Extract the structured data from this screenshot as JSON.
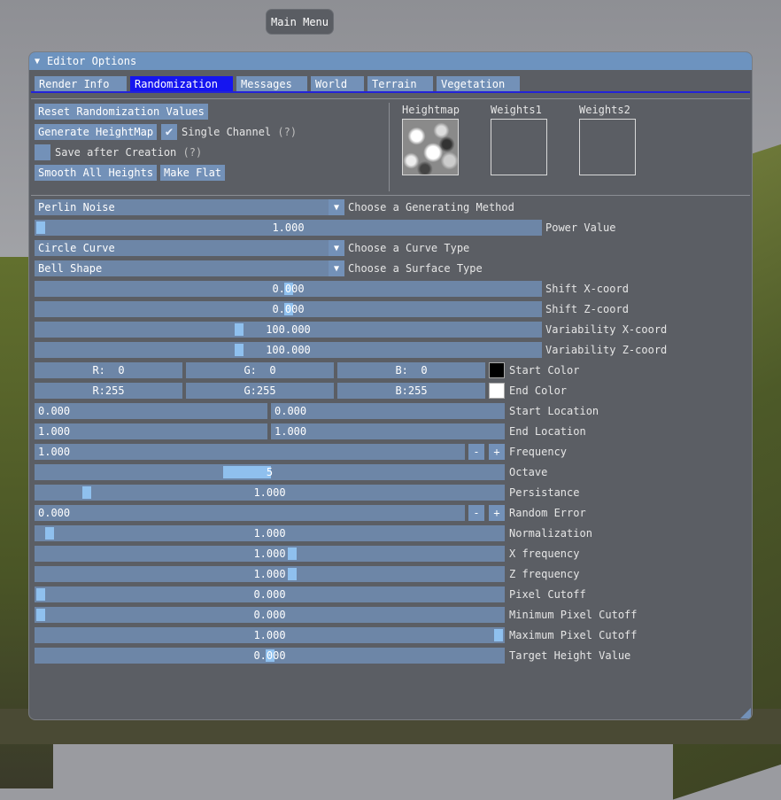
{
  "main_menu": "Main Menu",
  "window": {
    "title": "Editor Options",
    "tabs": [
      "Render Info",
      "Randomization",
      "Messages",
      "World",
      "Terrain",
      "Vegetation"
    ],
    "active_tab": "Randomization",
    "accent_color": "#1515f0"
  },
  "actions": {
    "reset": "Reset Randomization Values",
    "generate": "Generate HeightMap",
    "single_channel": "Single Channel",
    "single_channel_help": "(?)",
    "single_channel_checked": true,
    "save_after": "Save after Creation",
    "save_after_help": "(?)",
    "save_after_checked": false,
    "smooth": "Smooth All Heights",
    "flat": "Make Flat"
  },
  "previews": {
    "heightmap": "Heightmap",
    "weights1": "Weights1",
    "weights2": "Weights2"
  },
  "settings": {
    "method": {
      "value": "Perlin Noise",
      "label": "Choose a Generating Method"
    },
    "power": {
      "value": "1.000",
      "label": "Power Value",
      "fraction": 0.0
    },
    "curve": {
      "value": "Circle Curve",
      "label": "Choose a Curve Type"
    },
    "surface": {
      "value": "Bell Shape",
      "label": "Choose a Surface Type"
    },
    "shift_x": {
      "value": "0.000",
      "label": "Shift X-coord",
      "fraction": 0.5
    },
    "shift_z": {
      "value": "0.000",
      "label": "Shift Z-coord",
      "fraction": 0.5
    },
    "var_x": {
      "value": "100.000",
      "label": "Variability X-coord",
      "fraction": 0.4
    },
    "var_z": {
      "value": "100.000",
      "label": "Variability Z-coord",
      "fraction": 0.4
    },
    "start_color": {
      "r": "R:  0",
      "g": "G:  0",
      "b": "B:  0",
      "label": "Start Color",
      "swatch": "#000000"
    },
    "end_color": {
      "r": "R:255",
      "g": "G:255",
      "b": "B:255",
      "label": "End Color",
      "swatch": "#ffffff"
    },
    "start_location": {
      "a": "0.000",
      "b": "0.000",
      "label": "Start Location"
    },
    "end_location": {
      "a": "1.000",
      "b": "1.000",
      "label": "End Location"
    },
    "frequency": {
      "value": "1.000",
      "label": "Frequency"
    },
    "octave": {
      "value": "5",
      "label": "Octave"
    },
    "persistance": {
      "value": "1.000",
      "label": "Persistance",
      "fraction": 0.1
    },
    "random_error": {
      "value": "0.000",
      "label": "Random Error"
    },
    "normalization": {
      "value": "1.000",
      "label": "Normalization",
      "fraction": 0.02
    },
    "x_frequency": {
      "value": "1.000",
      "label": "X frequency",
      "fraction": 0.55
    },
    "z_frequency": {
      "value": "1.000",
      "label": "Z frequency",
      "fraction": 0.55
    },
    "pixel_cutoff": {
      "value": "0.000",
      "label": "Pixel Cutoff",
      "fraction": 0.0
    },
    "min_pixel_cutoff": {
      "value": "0.000",
      "label": "Minimum Pixel Cutoff",
      "fraction": 0.0
    },
    "max_pixel_cutoff": {
      "value": "1.000",
      "label": "Maximum Pixel Cutoff",
      "fraction": 1.0
    },
    "target_height": {
      "value": "0.000",
      "label": "Target Height Value",
      "fraction": 0.5
    }
  },
  "stepper": {
    "minus": "-",
    "plus": "+"
  }
}
